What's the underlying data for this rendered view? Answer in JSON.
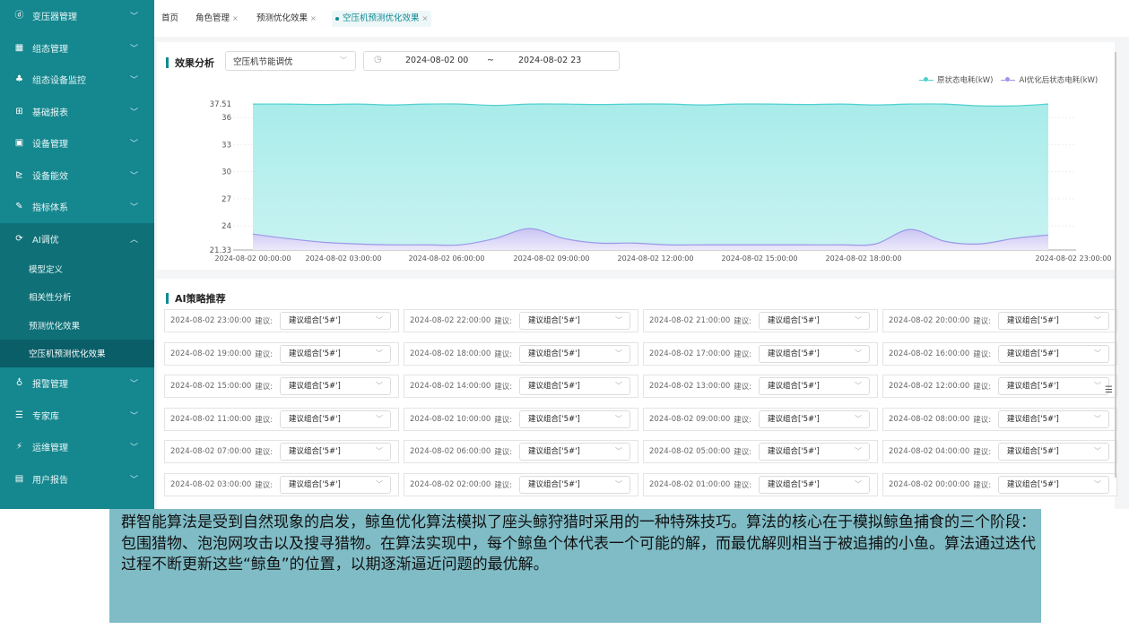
{
  "sidebar": {
    "items": [
      {
        "icon": "transformer-icon",
        "glyph": "ⓓ",
        "label": "变压器管理",
        "chev": "﹀"
      },
      {
        "icon": "config-icon",
        "glyph": "▦",
        "label": "组态管理",
        "chev": "﹀"
      },
      {
        "icon": "network-icon",
        "glyph": "♣",
        "label": "组态设备监控",
        "chev": "﹀"
      },
      {
        "icon": "report-icon",
        "glyph": "⊞",
        "label": "基础报表",
        "chev": "﹀"
      },
      {
        "icon": "device-icon",
        "glyph": "▣",
        "label": "设备管理",
        "chev": "﹀"
      },
      {
        "icon": "efficiency-icon",
        "glyph": "⊵",
        "label": "设备能效",
        "chev": "﹀"
      },
      {
        "icon": "index-icon",
        "glyph": "✎",
        "label": "指标体系",
        "chev": "﹀"
      },
      {
        "icon": "ai-icon",
        "glyph": "⟳",
        "label": "AI调优",
        "chev": "︿"
      }
    ],
    "sub_items": [
      "模型定义",
      "相关性分析",
      "预测优化效果",
      "空压机预测优化效果"
    ],
    "items_after": [
      {
        "icon": "alarm-icon",
        "glyph": "♁",
        "label": "报警管理",
        "chev": "﹀"
      },
      {
        "icon": "expert-icon",
        "glyph": "☰",
        "label": "专家库",
        "chev": "﹀"
      },
      {
        "icon": "maintenance-icon",
        "glyph": "⚡",
        "label": "运维管理",
        "chev": "﹀"
      },
      {
        "icon": "user-report-icon",
        "glyph": "▤",
        "label": "用户报告",
        "chev": "﹀"
      }
    ]
  },
  "tabs": {
    "home": "首页",
    "role": "角色管理",
    "forecast": "预测优化效果",
    "compressor": "空压机预测优化效果",
    "close": "×"
  },
  "analysis": {
    "title": "效果分析",
    "device_select": "空压机节能调优",
    "date_start": "2024-08-02 00",
    "date_sep": "~",
    "date_end": "2024-08-02 23",
    "legend": [
      {
        "name": "原状态电耗(kW)",
        "color": "#4fd0cf"
      },
      {
        "name": "AI优化后状态电耗(kW)",
        "color": "#9c98e8"
      }
    ]
  },
  "chart_data": {
    "type": "area",
    "y_ticks": [
      "37.51",
      "36",
      "33",
      "30",
      "27",
      "24",
      "21.33"
    ],
    "ylim": [
      21.33,
      37.51
    ],
    "x_labels": [
      "2024-08-02 00:00:00",
      "2024-08-02 03:00:00",
      "2024-08-02 06:00:00",
      "2024-08-02 09:00:00",
      "2024-08-02 12:00:00",
      "2024-08-02 15:00:00",
      "2024-08-02 18:00:00",
      "2024-08-02 23:00:00"
    ],
    "x": [
      0,
      1,
      2,
      3,
      4,
      5,
      6,
      7,
      8,
      9,
      10,
      11,
      12,
      13,
      14,
      15,
      16,
      17,
      18,
      19,
      20,
      21,
      22,
      23
    ],
    "series": [
      {
        "name": "原状态电耗(kW)",
        "color": "#4fd0cf",
        "values": [
          37.5,
          37.5,
          37.45,
          37.5,
          37.4,
          37.5,
          37.5,
          37.35,
          37.5,
          37.5,
          37.45,
          37.5,
          37.5,
          37.4,
          37.5,
          37.5,
          37.45,
          37.5,
          37.4,
          37.5,
          37.5,
          37.3,
          37.3,
          37.5
        ]
      },
      {
        "name": "AI优化后状态电耗(kW)",
        "color": "#9c98e8",
        "values": [
          23.1,
          22.6,
          22.2,
          22.0,
          21.9,
          21.9,
          21.9,
          22.6,
          23.7,
          22.6,
          22.1,
          22.1,
          21.9,
          21.9,
          21.9,
          21.9,
          21.9,
          21.9,
          22.0,
          23.6,
          22.3,
          22.0,
          22.6,
          23.0
        ]
      }
    ]
  },
  "strategy": {
    "title": "AI策略推荐",
    "label": "建议:",
    "chev": "﹀",
    "rows": [
      [
        {
          "time": "2024-08-02 23:00:00",
          "value": "建议组合['5#']"
        },
        {
          "time": "2024-08-02 22:00:00",
          "value": "建议组合['5#']"
        },
        {
          "time": "2024-08-02 21:00:00",
          "value": "建议组合['5#']"
        },
        {
          "time": "2024-08-02 20:00:00",
          "value": "建议组合['5#']"
        }
      ],
      [
        {
          "time": "2024-08-02 19:00:00",
          "value": "建议组合['5#']"
        },
        {
          "time": "2024-08-02 18:00:00",
          "value": "建议组合['5#']"
        },
        {
          "time": "2024-08-02 17:00:00",
          "value": "建议组合['5#']"
        },
        {
          "time": "2024-08-02 16:00:00",
          "value": "建议组合['5#']"
        }
      ],
      [
        {
          "time": "2024-08-02 15:00:00",
          "value": "建议组合['5#']"
        },
        {
          "time": "2024-08-02 14:00:00",
          "value": "建议组合['5#']"
        },
        {
          "time": "2024-08-02 13:00:00",
          "value": "建议组合['5#']"
        },
        {
          "time": "2024-08-02 12:00:00",
          "value": "建议组合['5#']"
        }
      ],
      [
        {
          "time": "2024-08-02 11:00:00",
          "value": "建议组合['5#']"
        },
        {
          "time": "2024-08-02 10:00:00",
          "value": "建议组合['5#']"
        },
        {
          "time": "2024-08-02 09:00:00",
          "value": "建议组合['5#']"
        },
        {
          "time": "2024-08-02 08:00:00",
          "value": "建议组合['5#']"
        }
      ],
      [
        {
          "time": "2024-08-02 07:00:00",
          "value": "建议组合['5#']"
        },
        {
          "time": "2024-08-02 06:00:00",
          "value": "建议组合['5#']"
        },
        {
          "time": "2024-08-02 05:00:00",
          "value": "建议组合['5#']"
        },
        {
          "time": "2024-08-02 04:00:00",
          "value": "建议组合['5#']"
        }
      ],
      [
        {
          "time": "2024-08-02 03:00:00",
          "value": "建议组合['5#']"
        },
        {
          "time": "2024-08-02 02:00:00",
          "value": "建议组合['5#']"
        },
        {
          "time": "2024-08-02 01:00:00",
          "value": "建议组合['5#']"
        },
        {
          "time": "2024-08-02 00:00:00",
          "value": "建议组合['5#']"
        }
      ]
    ]
  },
  "caption": {
    "text": "群智能算法是受到自然现象的启发，鲸鱼优化算法模拟了座头鲸狩猎时采用的一种特殊技巧。算法的核心在于模拟鲸鱼捕食的三个阶段：包围猎物、泡泡网攻击以及搜寻猎物。在算法实现中，每个鲸鱼个体代表一个可能的解，而最优解则相当于被追捕的小鱼。算法通过迭代过程不断更新这些“鲸鱼”的位置，以期逐渐逼近问题的最优解。"
  },
  "icons": {
    "clock": "◷",
    "settings": "☰"
  }
}
